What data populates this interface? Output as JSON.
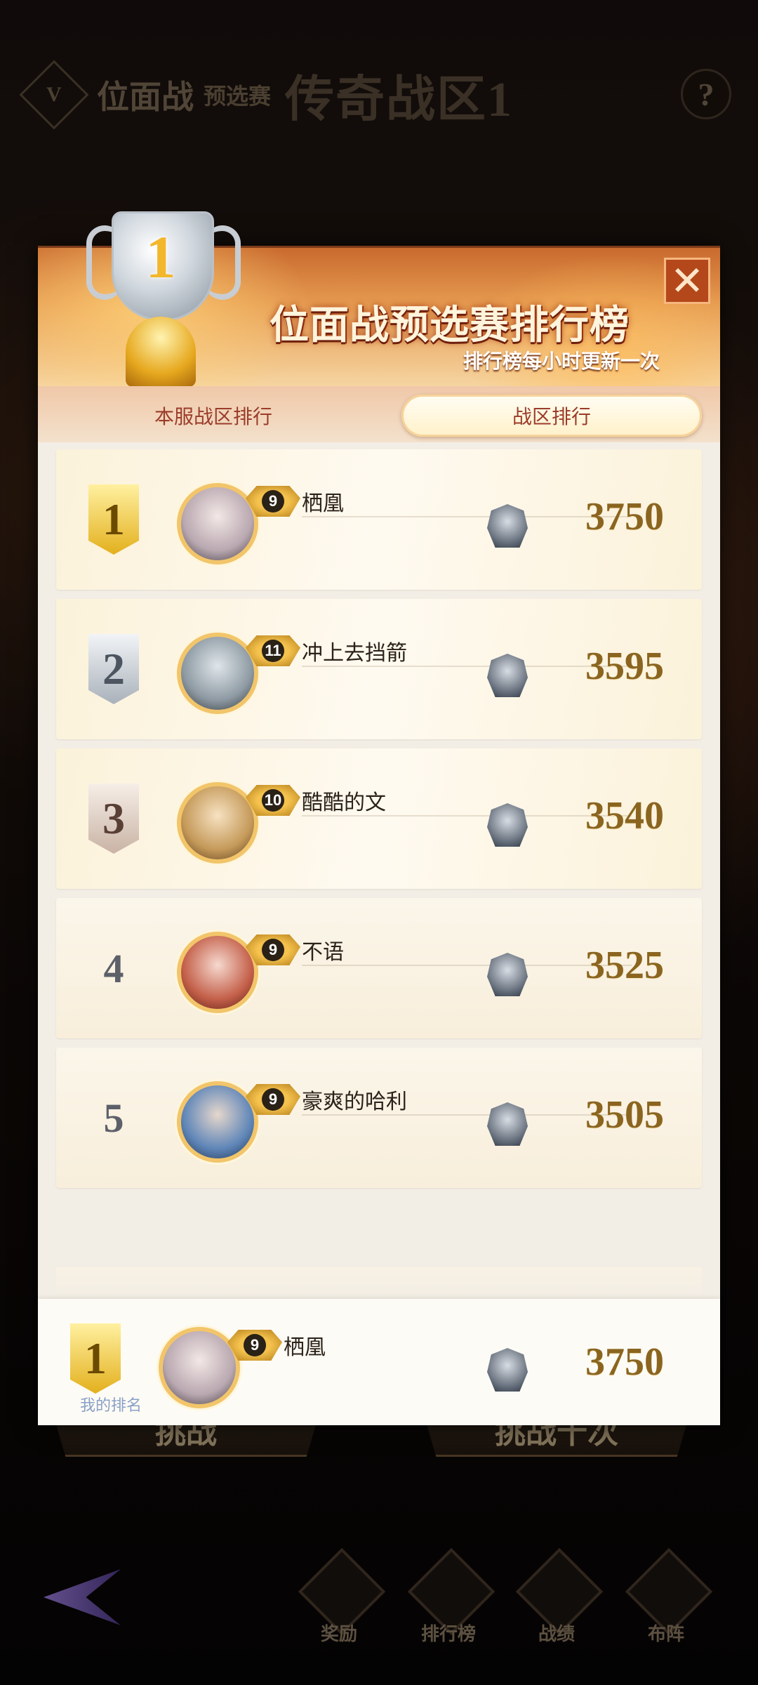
{
  "background": {
    "title_main": "位面战",
    "title_sub": "预选赛",
    "zone_title": "传奇战区1",
    "help_icon_text": "?",
    "buttons": [
      "挑战",
      "挑战十次"
    ],
    "nav": [
      {
        "label": "奖励",
        "icon": "gift-icon"
      },
      {
        "label": "排行榜",
        "icon": "crown-icon"
      },
      {
        "label": "战绩",
        "icon": "swords-icon"
      },
      {
        "label": "布阵",
        "icon": "chess-knight-icon"
      }
    ]
  },
  "modal": {
    "title": "位面战预选赛排行榜",
    "subtitle": "排行榜每小时更新一次",
    "close_symbol": "✕",
    "tabs": [
      {
        "label": "本服战区排行",
        "active": false
      },
      {
        "label": "战区排行",
        "active": true
      }
    ],
    "rows": [
      {
        "rank": "1",
        "name": "栖凰",
        "level": "9",
        "score": "3750"
      },
      {
        "rank": "2",
        "name": "冲上去挡箭",
        "level": "11",
        "score": "3595"
      },
      {
        "rank": "3",
        "name": "酷酷的文",
        "level": "10",
        "score": "3540"
      },
      {
        "rank": "4",
        "name": "不语",
        "level": "9",
        "score": "3525"
      },
      {
        "rank": "5",
        "name": "豪爽的哈利",
        "level": "9",
        "score": "3505"
      }
    ],
    "mine": {
      "rank": "1",
      "name": "栖凰",
      "level": "9",
      "score": "3750",
      "label": "我的排名"
    },
    "colors": {
      "accent": "#b4481b",
      "score": "#8b6520",
      "gold": "#e3b01e"
    }
  }
}
